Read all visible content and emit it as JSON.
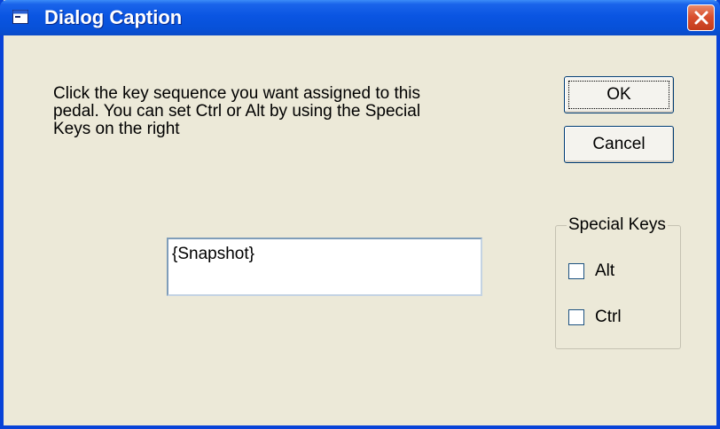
{
  "window": {
    "title": "Dialog Caption",
    "icon": "window-app-icon",
    "close_icon": "close-x-icon"
  },
  "dialog": {
    "prompt": "Click the key sequence you want assigned to this\npedal.  You can set Ctrl or Alt by using the Special\nKeys on the right",
    "key_value": "{Snapshot}",
    "ok_label": "OK",
    "cancel_label": "Cancel"
  },
  "special_keys": {
    "legend": "Special Keys",
    "alt": {
      "label": "Alt",
      "checked": false
    },
    "ctrl": {
      "label": "Ctrl",
      "checked": false
    }
  },
  "colors": {
    "titlebar": "#0a55e2",
    "face": "#ece9d8",
    "close_button": "#d9502f"
  }
}
